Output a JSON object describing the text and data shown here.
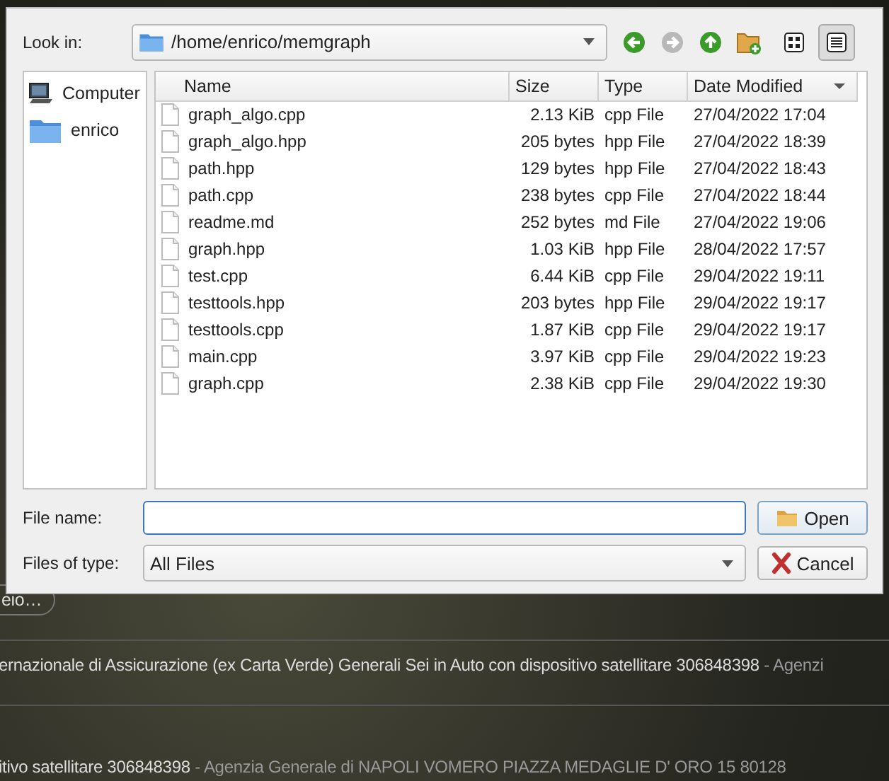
{
  "background": {
    "chip": "eio…",
    "lines": [
      {
        "text": "ernazionale di Assicurazione (ex Carta Verde) Generali Sei in Auto con dispositivo satellitare 306848398",
        "suffix": "- Agenzi"
      },
      {
        "text": "itivo satellitare 306848398",
        "suffix": "- Agenzia Generale di NAPOLI VOMERO PIAZZA MEDAGLIE D' ORO 15 80128"
      }
    ]
  },
  "dialog": {
    "look_in": {
      "label": "Look in:",
      "path": "/home/enrico/memgraph"
    },
    "toolbar": [
      {
        "kind": "back",
        "disabled": false
      },
      {
        "kind": "forward",
        "disabled": true
      },
      {
        "kind": "up",
        "disabled": false
      },
      {
        "kind": "new-folder",
        "disabled": false
      }
    ],
    "views": [
      {
        "kind": "icons",
        "selected": false
      },
      {
        "kind": "detail",
        "selected": true
      }
    ],
    "sidebar": [
      {
        "kind": "computer",
        "label": "Computer"
      },
      {
        "kind": "folder",
        "label": "enrico"
      }
    ],
    "columns": [
      {
        "label": "Name",
        "sorted": false
      },
      {
        "label": "Size",
        "sorted": false
      },
      {
        "label": "Type",
        "sorted": false
      },
      {
        "label": "Date Modified",
        "sorted": true
      }
    ],
    "rows": [
      {
        "name": "graph_algo.cpp",
        "size": "2.13 KiB",
        "type": "cpp File",
        "date": "27/04/2022 17:04"
      },
      {
        "name": "graph_algo.hpp",
        "size": "205 bytes",
        "type": "hpp File",
        "date": "27/04/2022 18:39"
      },
      {
        "name": "path.hpp",
        "size": "129 bytes",
        "type": "hpp File",
        "date": "27/04/2022 18:43"
      },
      {
        "name": "path.cpp",
        "size": "238 bytes",
        "type": "cpp File",
        "date": "27/04/2022 18:44"
      },
      {
        "name": "readme.md",
        "size": "252 bytes",
        "type": "md File",
        "date": "27/04/2022 19:06"
      },
      {
        "name": "graph.hpp",
        "size": "1.03 KiB",
        "type": "hpp File",
        "date": "28/04/2022 17:57"
      },
      {
        "name": "test.cpp",
        "size": "6.44 KiB",
        "type": "cpp File",
        "date": "29/04/2022 19:11"
      },
      {
        "name": "testtools.hpp",
        "size": "203 bytes",
        "type": "hpp File",
        "date": "29/04/2022 19:17"
      },
      {
        "name": "testtools.cpp",
        "size": "1.87 KiB",
        "type": "cpp File",
        "date": "29/04/2022 19:17"
      },
      {
        "name": "main.cpp",
        "size": "3.97 KiB",
        "type": "cpp File",
        "date": "29/04/2022 19:23"
      },
      {
        "name": "graph.cpp",
        "size": "2.38 KiB",
        "type": "cpp File",
        "date": "29/04/2022 19:30"
      }
    ],
    "file_name": {
      "label": "File name:",
      "focused": true
    },
    "file_type": {
      "label": "Files of type:",
      "value": "All Files"
    },
    "buttons": [
      {
        "kind": "open",
        "label": "Open"
      },
      {
        "kind": "cancel",
        "label": "Cancel"
      }
    ]
  }
}
